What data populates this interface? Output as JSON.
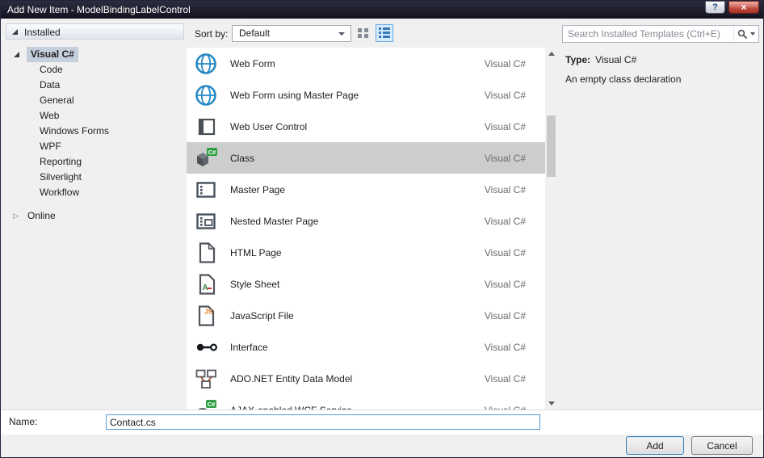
{
  "window": {
    "title": "Add New Item - ModelBindingLabelControl",
    "help_icon": "?",
    "close_icon": "×"
  },
  "sidebar": {
    "installed_label": "Installed",
    "online_label": "Online",
    "tree": {
      "root": "Visual C#",
      "children": [
        "Code",
        "Data",
        "General",
        "Web",
        "Windows Forms",
        "WPF",
        "Reporting",
        "Silverlight",
        "Workflow"
      ]
    }
  },
  "toolbar": {
    "sort_by_label": "Sort by:",
    "sort_value": "Default"
  },
  "search": {
    "placeholder": "Search Installed Templates (Ctrl+E)"
  },
  "templates": [
    {
      "name": "Web Form",
      "lang": "Visual C#",
      "icon": "web-form-globe-icon",
      "selected": false
    },
    {
      "name": "Web Form using Master Page",
      "lang": "Visual C#",
      "icon": "web-form-master-globe-icon",
      "selected": false
    },
    {
      "name": "Web User Control",
      "lang": "Visual C#",
      "icon": "web-user-control-icon",
      "selected": false
    },
    {
      "name": "Class",
      "lang": "Visual C#",
      "icon": "class-icon",
      "selected": true
    },
    {
      "name": "Master Page",
      "lang": "Visual C#",
      "icon": "master-page-icon",
      "selected": false
    },
    {
      "name": "Nested Master Page",
      "lang": "Visual C#",
      "icon": "nested-master-page-icon",
      "selected": false
    },
    {
      "name": "HTML Page",
      "lang": "Visual C#",
      "icon": "html-page-icon",
      "selected": false
    },
    {
      "name": "Style Sheet",
      "lang": "Visual C#",
      "icon": "style-sheet-icon",
      "selected": false
    },
    {
      "name": "JavaScript File",
      "lang": "Visual C#",
      "icon": "javascript-file-icon",
      "selected": false
    },
    {
      "name": "Interface",
      "lang": "Visual C#",
      "icon": "interface-icon",
      "selected": false
    },
    {
      "name": "ADO.NET Entity Data Model",
      "lang": "Visual C#",
      "icon": "ado-net-entity-icon",
      "selected": false
    },
    {
      "name": "AJAX-enabled WCF Service",
      "lang": "Visual C#",
      "icon": "ajax-wcf-icon",
      "selected": false
    }
  ],
  "details": {
    "type_label": "Type:",
    "type_value": "Visual C#",
    "description": "An empty class declaration"
  },
  "footer": {
    "name_label": "Name:",
    "name_value": "Contact.cs",
    "add_label": "Add",
    "cancel_label": "Cancel"
  },
  "colors": {
    "accent_blue": "#2688c6",
    "close_red": "#c04a3e",
    "selected_row_gray": "#cdcdcd",
    "tree_selection": "#c5cfdb",
    "focus_border": "#5899d2"
  }
}
